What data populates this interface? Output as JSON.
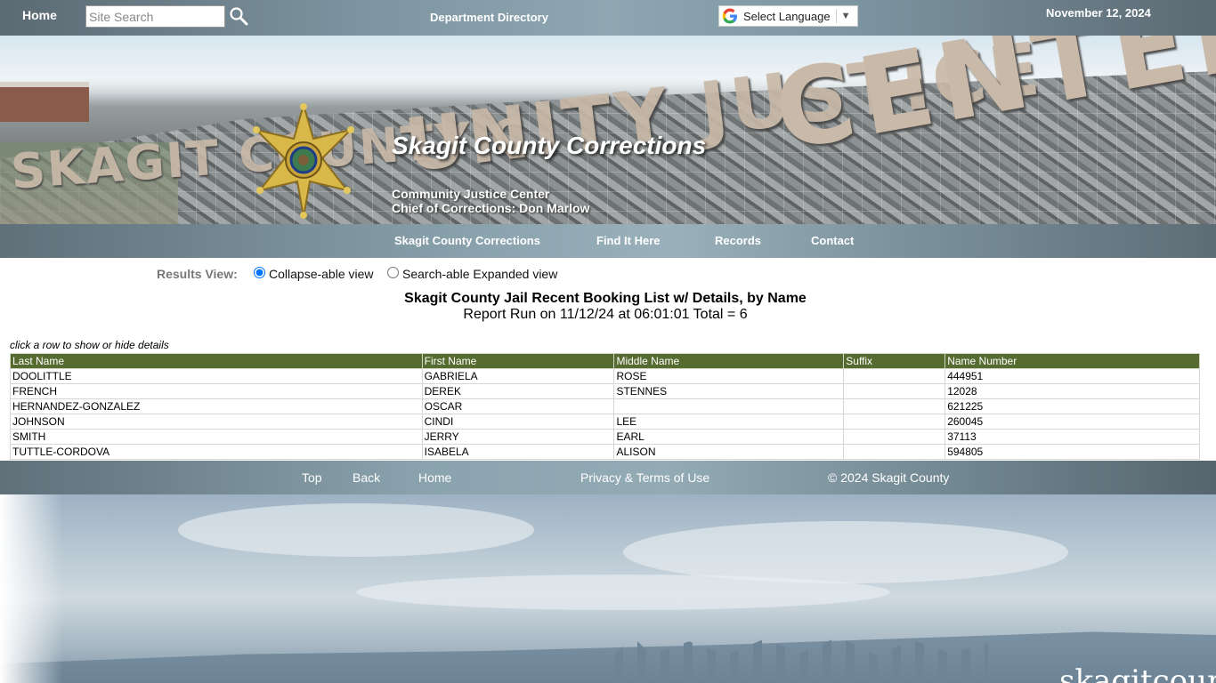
{
  "topbar": {
    "home_label": "Home",
    "search_placeholder": "Site Search",
    "dept_label": "Department Directory",
    "language_label": "Select Language",
    "date": "November 12, 2024"
  },
  "banner": {
    "title": "Skagit County Corrections",
    "subtitle_line1": "Community Justice Center",
    "subtitle_line2": "Chief of Corrections: Don Marlow",
    "wall_text_left": "SKAGIT COUNTY C",
    "wall_text_mid": "UNITY JUSTICE",
    "wall_text_right": "CENTER"
  },
  "nav": {
    "items": [
      {
        "label": "Skagit County Corrections"
      },
      {
        "label": "Find It Here"
      },
      {
        "label": "Records"
      },
      {
        "label": "Contact"
      }
    ]
  },
  "results": {
    "view_label": "Results View:",
    "option_collapse": "Collapse-able view",
    "option_expanded": "Search-able Expanded view",
    "selected": "collapse"
  },
  "report": {
    "title": "Skagit County Jail Recent Booking List w/ Details, by Name",
    "subtitle": "Report Run on 11/12/24 at 06:01:01 Total = 6",
    "hint": "click a row to show or hide details"
  },
  "table": {
    "headers": [
      "Last Name",
      "First Name",
      "Middle Name",
      "Suffix",
      "Name Number"
    ],
    "rows": [
      [
        "DOOLITTLE",
        "GABRIELA",
        "ROSE",
        "",
        "444951"
      ],
      [
        "FRENCH",
        "DEREK",
        "STENNES",
        "",
        "12028"
      ],
      [
        "HERNANDEZ-GONZALEZ",
        "OSCAR",
        "",
        "",
        "621225"
      ],
      [
        "JOHNSON",
        "CINDI",
        "LEE",
        "",
        "260045"
      ],
      [
        "SMITH",
        "JERRY",
        "EARL",
        "",
        "37113"
      ],
      [
        "TUTTLE-CORDOVA",
        "ISABELA",
        "ALISON",
        "",
        "594805"
      ]
    ]
  },
  "footer": {
    "top": "Top",
    "back": "Back",
    "home": "Home",
    "privacy": "Privacy & Terms of Use",
    "copyright": "© 2024 Skagit County"
  },
  "landscape": {
    "brand": "skagitcounty"
  },
  "colors": {
    "table_header": "#556b2f",
    "bar_gradient_mid": "#8ea6b1"
  },
  "icons": {
    "search": "search-icon",
    "google": "google-icon",
    "badge": "sheriff-star-badge-icon"
  }
}
